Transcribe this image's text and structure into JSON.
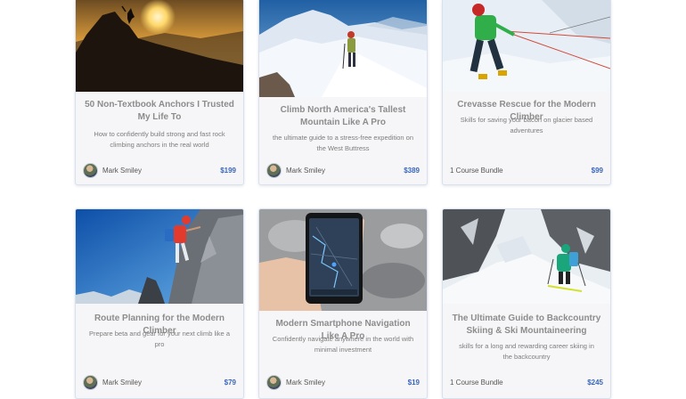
{
  "courses": [
    {
      "title": "50 Non-Textbook Anchors I Trusted My Life To",
      "description": "How to confidently build strong and fast rock climbing anchors in the real world",
      "author": "Mark Smiley",
      "price": "$199",
      "image": "summit-sunset-photo"
    },
    {
      "title": "Climb North America's Tallest Mountain Like A Pro",
      "description": "the ultimate guide to a stress-free expedition on the West Buttress",
      "author": "Mark Smiley",
      "price": "$389",
      "image": "snowy-ridge-climber-photo"
    },
    {
      "title": "Crevasse Rescue for the Modern Climber",
      "description": "Skills for saving your bacon on glacier based adventures",
      "bundle": "1 Course Bundle",
      "price": "$99",
      "image": "crevasse-rescue-photo"
    },
    {
      "title": "Route Planning for the Modern Climber",
      "description": "Prepare beta and gear for your next climb like a pro",
      "author": "Mark Smiley",
      "price": "$79",
      "image": "rock-climber-blue-sky-photo"
    },
    {
      "title": "Modern Smartphone Navigation Like A Pro",
      "description": "Confidently navigate anywhere in the world with minimal investment",
      "author": "Mark Smiley",
      "price": "$19",
      "image": "smartphone-map-photo"
    },
    {
      "title": "The Ultimate Guide to Backcountry Skiing & Ski Mountaineering",
      "description": "skills for a long and rewarding career skiing in the backcountry",
      "bundle": "1 Course Bundle",
      "price": "$245",
      "image": "backcountry-skier-photo"
    }
  ]
}
